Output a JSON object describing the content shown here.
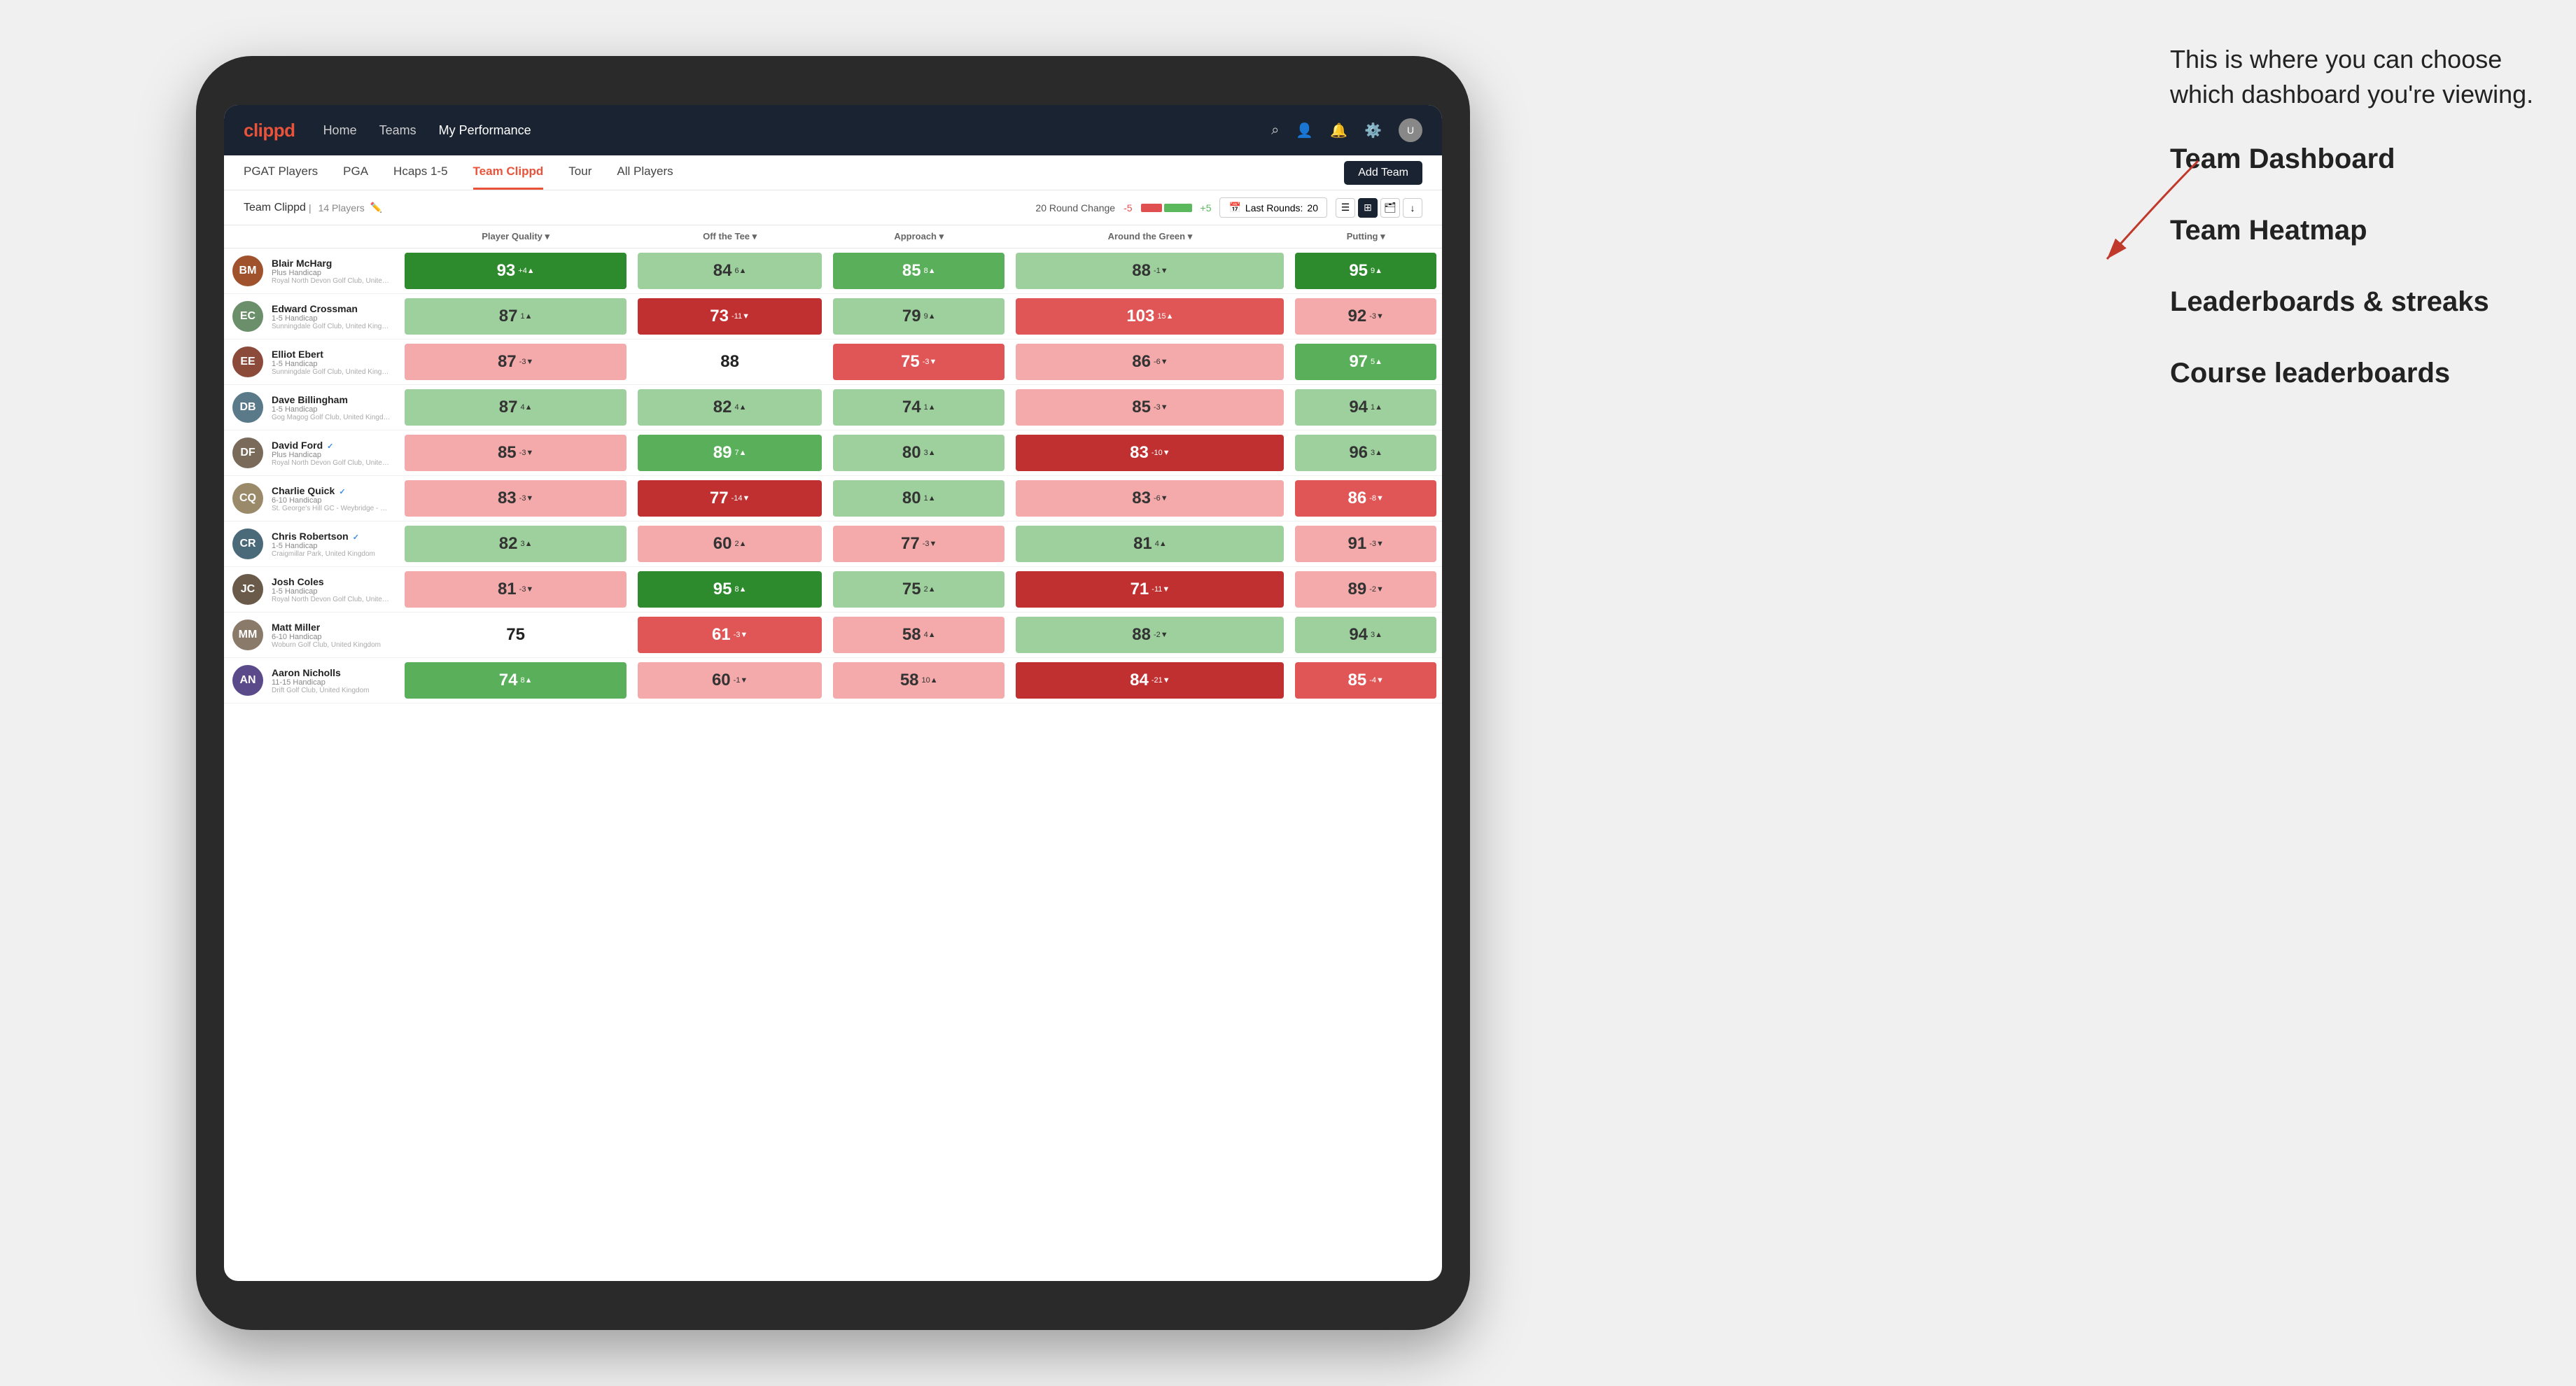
{
  "annotation": {
    "intro": "This is where you can choose which dashboard you're viewing.",
    "options": [
      "Team Dashboard",
      "Team Heatmap",
      "Leaderboards & streaks",
      "Course leaderboards"
    ]
  },
  "navbar": {
    "logo": "clippd",
    "links": [
      "Home",
      "Teams",
      "My Performance"
    ],
    "active_link": "My Performance"
  },
  "subnav": {
    "tabs": [
      "PGAT Players",
      "PGA",
      "Hcaps 1-5",
      "Team Clippd",
      "Tour",
      "All Players"
    ],
    "active_tab": "Team Clippd",
    "add_team_label": "Add Team"
  },
  "team_bar": {
    "team_name": "Team Clippd",
    "player_count": "14 Players",
    "round_change_label": "20 Round Change",
    "round_change_neg": "-5",
    "round_change_pos": "+5",
    "last_rounds_label": "Last Rounds:",
    "last_rounds_value": "20"
  },
  "table": {
    "columns": [
      "Player Quality ▾",
      "Off the Tee ▾",
      "Approach ▾",
      "Around the Green ▾",
      "Putting ▾"
    ],
    "players": [
      {
        "name": "Blair McHarg",
        "handicap": "Plus Handicap",
        "club": "Royal North Devon Golf Club, United Kingdom",
        "verified": false,
        "initials": "BM",
        "avatar_color": "#a0522d",
        "scores": [
          {
            "value": 93,
            "delta": "+4",
            "direction": "up",
            "color": "green-dark"
          },
          {
            "value": 84,
            "delta": "6",
            "direction": "up",
            "color": "green-light"
          },
          {
            "value": 85,
            "delta": "8",
            "direction": "up",
            "color": "green-med"
          },
          {
            "value": 88,
            "delta": "-1",
            "direction": "down",
            "color": "green-light"
          },
          {
            "value": 95,
            "delta": "9",
            "direction": "up",
            "color": "green-dark"
          }
        ]
      },
      {
        "name": "Edward Crossman",
        "handicap": "1-5 Handicap",
        "club": "Sunningdale Golf Club, United Kingdom",
        "verified": false,
        "initials": "EC",
        "avatar_color": "#6b8e6b",
        "scores": [
          {
            "value": 87,
            "delta": "1",
            "direction": "up",
            "color": "green-light"
          },
          {
            "value": 73,
            "delta": "-11",
            "direction": "down",
            "color": "red-dark"
          },
          {
            "value": 79,
            "delta": "9",
            "direction": "up",
            "color": "green-light"
          },
          {
            "value": 103,
            "delta": "15",
            "direction": "up",
            "color": "red-med"
          },
          {
            "value": 92,
            "delta": "-3",
            "direction": "down",
            "color": "red-light"
          }
        ]
      },
      {
        "name": "Elliot Ebert",
        "handicap": "1-5 Handicap",
        "club": "Sunningdale Golf Club, United Kingdom",
        "verified": false,
        "initials": "EE",
        "avatar_color": "#8b4a3a",
        "scores": [
          {
            "value": 87,
            "delta": "-3",
            "direction": "down",
            "color": "red-light"
          },
          {
            "value": 88,
            "delta": "",
            "direction": "",
            "color": "white-bg"
          },
          {
            "value": 75,
            "delta": "-3",
            "direction": "down",
            "color": "red-med"
          },
          {
            "value": 86,
            "delta": "-6",
            "direction": "down",
            "color": "red-light"
          },
          {
            "value": 97,
            "delta": "5",
            "direction": "up",
            "color": "green-med"
          }
        ]
      },
      {
        "name": "Dave Billingham",
        "handicap": "1-5 Handicap",
        "club": "Gog Magog Golf Club, United Kingdom",
        "verified": false,
        "initials": "DB",
        "avatar_color": "#5a7a8a",
        "scores": [
          {
            "value": 87,
            "delta": "4",
            "direction": "up",
            "color": "green-light"
          },
          {
            "value": 82,
            "delta": "4",
            "direction": "up",
            "color": "green-light"
          },
          {
            "value": 74,
            "delta": "1",
            "direction": "up",
            "color": "green-light"
          },
          {
            "value": 85,
            "delta": "-3",
            "direction": "down",
            "color": "red-light"
          },
          {
            "value": 94,
            "delta": "1",
            "direction": "up",
            "color": "green-light"
          }
        ]
      },
      {
        "name": "David Ford",
        "handicap": "Plus Handicap",
        "club": "Royal North Devon Golf Club, United Kingdom",
        "verified": true,
        "initials": "DF",
        "avatar_color": "#7a6a5a",
        "scores": [
          {
            "value": 85,
            "delta": "-3",
            "direction": "down",
            "color": "red-light"
          },
          {
            "value": 89,
            "delta": "7",
            "direction": "up",
            "color": "green-med"
          },
          {
            "value": 80,
            "delta": "3",
            "direction": "up",
            "color": "green-light"
          },
          {
            "value": 83,
            "delta": "-10",
            "direction": "down",
            "color": "red-dark"
          },
          {
            "value": 96,
            "delta": "3",
            "direction": "up",
            "color": "green-light"
          }
        ]
      },
      {
        "name": "Charlie Quick",
        "handicap": "6-10 Handicap",
        "club": "St. George's Hill GC - Weybridge - Surrey, Uni...",
        "verified": true,
        "initials": "CQ",
        "avatar_color": "#9a8a6a",
        "scores": [
          {
            "value": 83,
            "delta": "-3",
            "direction": "down",
            "color": "red-light"
          },
          {
            "value": 77,
            "delta": "-14",
            "direction": "down",
            "color": "red-dark"
          },
          {
            "value": 80,
            "delta": "1",
            "direction": "up",
            "color": "green-light"
          },
          {
            "value": 83,
            "delta": "-6",
            "direction": "down",
            "color": "red-light"
          },
          {
            "value": 86,
            "delta": "-8",
            "direction": "down",
            "color": "red-med"
          }
        ]
      },
      {
        "name": "Chris Robertson",
        "handicap": "1-5 Handicap",
        "club": "Craigmillar Park, United Kingdom",
        "verified": true,
        "initials": "CR",
        "avatar_color": "#4a6a7a",
        "scores": [
          {
            "value": 82,
            "delta": "3",
            "direction": "up",
            "color": "green-light"
          },
          {
            "value": 60,
            "delta": "2",
            "direction": "up",
            "color": "red-light"
          },
          {
            "value": 77,
            "delta": "-3",
            "direction": "down",
            "color": "red-light"
          },
          {
            "value": 81,
            "delta": "4",
            "direction": "up",
            "color": "green-light"
          },
          {
            "value": 91,
            "delta": "-3",
            "direction": "down",
            "color": "red-light"
          }
        ]
      },
      {
        "name": "Josh Coles",
        "handicap": "1-5 Handicap",
        "club": "Royal North Devon Golf Club, United Kingdom",
        "verified": false,
        "initials": "JC",
        "avatar_color": "#6a5a4a",
        "scores": [
          {
            "value": 81,
            "delta": "-3",
            "direction": "down",
            "color": "red-light"
          },
          {
            "value": 95,
            "delta": "8",
            "direction": "up",
            "color": "green-dark"
          },
          {
            "value": 75,
            "delta": "2",
            "direction": "up",
            "color": "green-light"
          },
          {
            "value": 71,
            "delta": "-11",
            "direction": "down",
            "color": "red-dark"
          },
          {
            "value": 89,
            "delta": "-2",
            "direction": "down",
            "color": "red-light"
          }
        ]
      },
      {
        "name": "Matt Miller",
        "handicap": "6-10 Handicap",
        "club": "Woburn Golf Club, United Kingdom",
        "verified": false,
        "initials": "MM",
        "avatar_color": "#8a7a6a",
        "scores": [
          {
            "value": 75,
            "delta": "",
            "direction": "",
            "color": "white-bg"
          },
          {
            "value": 61,
            "delta": "-3",
            "direction": "down",
            "color": "red-med"
          },
          {
            "value": 58,
            "delta": "4",
            "direction": "up",
            "color": "red-light"
          },
          {
            "value": 88,
            "delta": "-2",
            "direction": "down",
            "color": "green-light"
          },
          {
            "value": 94,
            "delta": "3",
            "direction": "up",
            "color": "green-light"
          }
        ]
      },
      {
        "name": "Aaron Nicholls",
        "handicap": "11-15 Handicap",
        "club": "Drift Golf Club, United Kingdom",
        "verified": false,
        "initials": "AN",
        "avatar_color": "#5a4a8a",
        "scores": [
          {
            "value": 74,
            "delta": "8",
            "direction": "up",
            "color": "green-med"
          },
          {
            "value": 60,
            "delta": "-1",
            "direction": "down",
            "color": "red-light"
          },
          {
            "value": 58,
            "delta": "10",
            "direction": "up",
            "color": "red-light"
          },
          {
            "value": 84,
            "delta": "-21",
            "direction": "down",
            "color": "red-dark"
          },
          {
            "value": 85,
            "delta": "-4",
            "direction": "down",
            "color": "red-med"
          }
        ]
      }
    ]
  }
}
